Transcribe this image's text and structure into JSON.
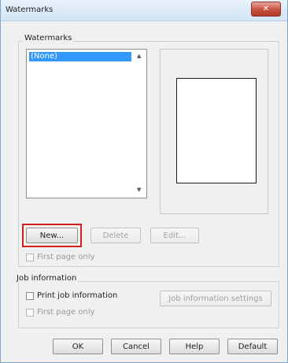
{
  "window": {
    "title": "Watermarks",
    "close_glyph": "✕"
  },
  "watermarks_group": {
    "label": "Watermarks",
    "list_items": [
      "(None)"
    ],
    "new_button": "New...",
    "delete_button": "Delete",
    "edit_button": "Edit...",
    "first_page_only": "First page only",
    "highlight_color": "#d21f1f"
  },
  "job_group": {
    "label": "Job information",
    "print_job_information": "Print job information",
    "job_information_settings": "Job information settings",
    "first_page_only": "First page only"
  },
  "footer": {
    "ok": "OK",
    "cancel": "Cancel",
    "help": "Help",
    "default": "Default"
  },
  "icons": {
    "scroll_up": "scroll-up-arrow-icon",
    "scroll_down": "scroll-down-arrow-icon"
  }
}
